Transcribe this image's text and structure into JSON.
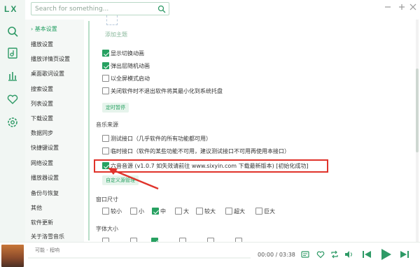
{
  "app": {
    "logo": "LX",
    "search_placeholder": "Search for something...",
    "accent": "#27a161"
  },
  "sidebar_icons": [
    "search-icon",
    "music-library-icon",
    "chart-icon",
    "heart-icon",
    "settings-icon"
  ],
  "nav": {
    "items": [
      "› 基本设置",
      "播放设置",
      "播放详情页设置",
      "桌面歌词设置",
      "搜索设置",
      "列表设置",
      "下载设置",
      "数据同步",
      "快捷键设置",
      "网络设置",
      "备份与恢复",
      "其他",
      "软件更新",
      "关于洛雪音乐"
    ],
    "partial_item": "播放器设置"
  },
  "main": {
    "add_theme": "添加主题",
    "display_options": [
      {
        "label": "显示切换动画",
        "checked": true
      },
      {
        "label": "弹出层随机动画",
        "checked": true
      },
      {
        "label": "以全屏模式启动",
        "checked": false
      },
      {
        "label": "关闭软件时不退出软件将其最小化到系统托盘",
        "checked": false
      }
    ],
    "timer_pause_btn": "定时暂停",
    "music_source_title": "音乐来源",
    "sources": [
      {
        "label": "测试接口（几乎软件的所有功能都可用）",
        "checked": false
      },
      {
        "label": "临时接口（软件的某些功能不可用，建议测试接口不可用再使用本接口）",
        "checked": false
      },
      {
        "label": "六音音源 (v1.0.7 如失效请前往 www.sixyin.com 下载最新版本) [初始化成功]",
        "checked": true
      }
    ],
    "custom_source_btn": "自定义源管理",
    "window_size_title": "窗口尺寸",
    "window_sizes": [
      {
        "label": "较小",
        "checked": false
      },
      {
        "label": "小",
        "checked": false
      },
      {
        "label": "中",
        "checked": true
      },
      {
        "label": "大",
        "checked": false
      },
      {
        "label": "较大",
        "checked": false
      },
      {
        "label": "超大",
        "checked": false
      },
      {
        "label": "巨大",
        "checked": false
      }
    ],
    "font_size_title": "字体大小"
  },
  "player": {
    "song": "可能 - 程响",
    "time": "00:00 / 03:38",
    "controls": [
      "lyric-icon",
      "heart-icon",
      "repeat-icon",
      "volume-icon",
      "prev-icon",
      "play-icon",
      "next-icon"
    ]
  }
}
